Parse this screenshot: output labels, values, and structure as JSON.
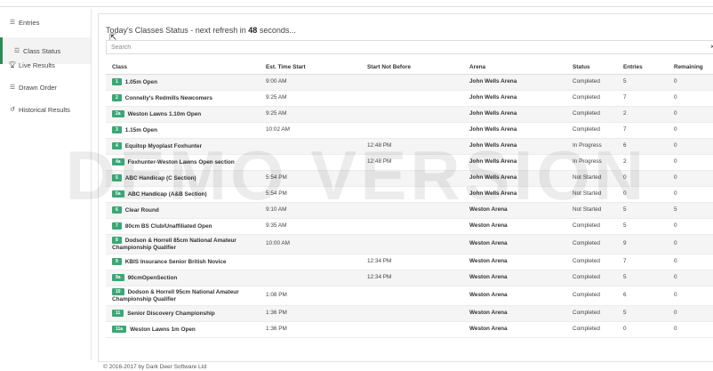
{
  "sidebar": {
    "items": [
      {
        "icon": "list-icon",
        "label": "Entries"
      },
      {
        "icon": "sliders-icon",
        "label": "Class Status"
      },
      {
        "icon": "trophy-icon",
        "label": "Live Results"
      },
      {
        "icon": "list-icon",
        "label": "Drawn Order"
      },
      {
        "icon": "history-icon",
        "label": "Historical Results"
      }
    ],
    "active": "Class Status"
  },
  "main": {
    "heading_prefix": "Today's Classes Status - next refresh in ",
    "refresh_seconds": "48",
    "heading_suffix": " seconds...",
    "search_placeholder": "Search"
  },
  "table": {
    "headers": [
      "Class",
      "Est. Time Start",
      "Start Not Before",
      "Arena",
      "Status",
      "Entries",
      "Remaining"
    ],
    "rows": [
      {
        "num": "1",
        "name": "1.05m Open",
        "est": "9:00 AM",
        "snb": "",
        "arena": "John Wells Arena",
        "status": "Completed",
        "entries": "5",
        "remaining": "0"
      },
      {
        "num": "2",
        "name": "Connelly's Redmills Newcomers",
        "est": "9:25 AM",
        "snb": "",
        "arena": "John Wells Arena",
        "status": "Completed",
        "entries": "7",
        "remaining": "0"
      },
      {
        "num": "2a",
        "name": "Weston Lawns 1.10m Open",
        "est": "9:25 AM",
        "snb": "",
        "arena": "John Wells Arena",
        "status": "Completed",
        "entries": "2",
        "remaining": "0"
      },
      {
        "num": "3",
        "name": "1.15m Open",
        "est": "10:02 AM",
        "snb": "",
        "arena": "John Wells Arena",
        "status": "Completed",
        "entries": "7",
        "remaining": "0"
      },
      {
        "num": "4",
        "name": "Equitop Myoplast Foxhunter",
        "est": "",
        "snb": "12:48 PM",
        "arena": "John Wells Arena",
        "status": "In Progress",
        "entries": "6",
        "remaining": "0"
      },
      {
        "num": "4a",
        "name": "Foxhunter-Weston Lawns Open section",
        "est": "",
        "snb": "12:48 PM",
        "arena": "John Wells Arena",
        "status": "In Progress",
        "entries": "2",
        "remaining": "0"
      },
      {
        "num": "5",
        "name": "ABC Handicap (C Section)",
        "est": "5:54 PM",
        "snb": "",
        "arena": "John Wells Arena",
        "status": "Not Started",
        "entries": "0",
        "remaining": "0"
      },
      {
        "num": "5a",
        "name": "ABC Handicap (A&B Section)",
        "est": "5:54 PM",
        "snb": "",
        "arena": "John Wells Arena",
        "status": "Not Started",
        "entries": "0",
        "remaining": "0"
      },
      {
        "num": "6",
        "name": "Clear Round",
        "est": "9:10 AM",
        "snb": "",
        "arena": "Weston Arena",
        "status": "Not Started",
        "entries": "5",
        "remaining": "5"
      },
      {
        "num": "7",
        "name": "80cm BS Club/Unaffiliated Open",
        "est": "9:35 AM",
        "snb": "",
        "arena": "Weston Arena",
        "status": "Completed",
        "entries": "5",
        "remaining": "0"
      },
      {
        "num": "8",
        "name": "Dodson & Horrell 85cm National Amateur Championship Qualifier",
        "est": "10:00 AM",
        "snb": "",
        "arena": "Weston Arena",
        "status": "Completed",
        "entries": "9",
        "remaining": "0"
      },
      {
        "num": "9",
        "name": "KBIS Insurance Senior British Novice",
        "est": "",
        "snb": "12:34 PM",
        "arena": "Weston Arena",
        "status": "Completed",
        "entries": "7",
        "remaining": "0"
      },
      {
        "num": "9a",
        "name": "90cmOpenSection",
        "est": "",
        "snb": "12:34 PM",
        "arena": "Weston Arena",
        "status": "Completed",
        "entries": "5",
        "remaining": "0"
      },
      {
        "num": "10",
        "name": "Dodson & Horrell 95cm National Amateur Championship Qualifier",
        "est": "1:08 PM",
        "snb": "",
        "arena": "Weston Arena",
        "status": "Completed",
        "entries": "6",
        "remaining": "0"
      },
      {
        "num": "11",
        "name": "Senior Discovery Championship",
        "est": "1:36 PM",
        "snb": "",
        "arena": "Weston Arena",
        "status": "Completed",
        "entries": "5",
        "remaining": "0"
      },
      {
        "num": "11a",
        "name": "Weston Lawns 1m Open",
        "est": "1:36 PM",
        "snb": "",
        "arena": "Weston Arena",
        "status": "Completed",
        "entries": "0",
        "remaining": "0"
      }
    ]
  },
  "watermark": "DEMO VERSION",
  "footer": "© 2016-2017 by Dark Deer Software Ltd",
  "colors": {
    "badge": "#3aa876",
    "active_border": "#2e8b57"
  }
}
